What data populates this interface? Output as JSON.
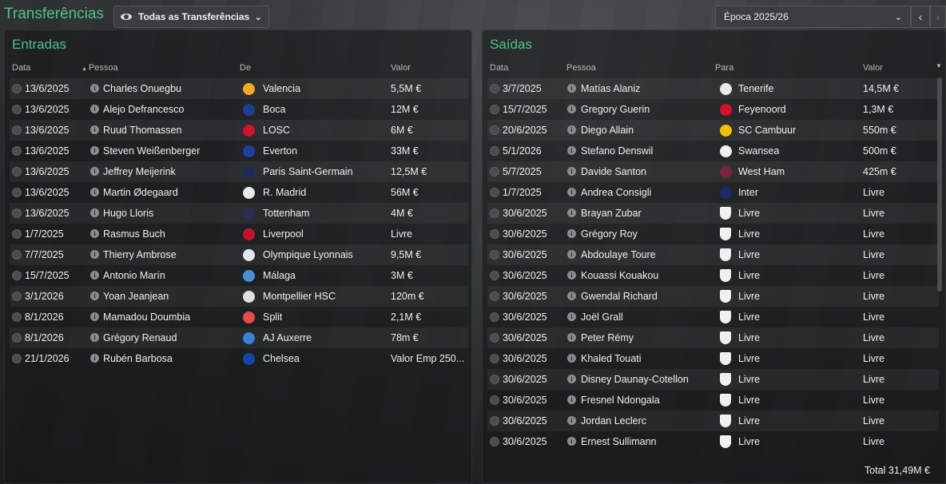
{
  "page": {
    "title": "Transferências",
    "filter_label": "Todas as Transferências",
    "season_label": "Época 2025/26"
  },
  "colors": {
    "accent": "#4fc28d"
  },
  "entradas": {
    "title": "Entradas",
    "headers": {
      "data": "Data",
      "pessoa": "Pessoa",
      "de": "De",
      "valor": "Valor"
    },
    "rows": [
      {
        "data": "13/6/2025",
        "pessoa": "Charles Onuegbu",
        "clube": "Valencia",
        "valor": "5,5M €",
        "badge": "#f5a623"
      },
      {
        "data": "13/6/2025",
        "pessoa": "Alejo Defrancesco",
        "clube": "Boca",
        "valor": "12M €",
        "badge": "#1d3f8f"
      },
      {
        "data": "13/6/2025",
        "pessoa": "Ruud Thomassen",
        "clube": "LOSC",
        "valor": "6M €",
        "badge": "#d0112b"
      },
      {
        "data": "13/6/2025",
        "pessoa": "Steven Weißenberger",
        "clube": "Everton",
        "valor": "33M €",
        "badge": "#1f3f9f"
      },
      {
        "data": "13/6/2025",
        "pessoa": "Jeffrey Meijerink",
        "clube": "Paris Saint-Germain",
        "valor": "12,5M €",
        "badge": "#1b2a5e"
      },
      {
        "data": "13/6/2025",
        "pessoa": "Martin Ødegaard",
        "clube": "R. Madrid",
        "valor": "56M €",
        "badge": "#e8e8e8"
      },
      {
        "data": "13/6/2025",
        "pessoa": "Hugo Lloris",
        "clube": "Tottenham",
        "valor": "4M €",
        "badge": "#2b2b5a"
      },
      {
        "data": "1/7/2025",
        "pessoa": "Rasmus Buch",
        "clube": "Liverpool",
        "valor": "Livre",
        "badge": "#c8102e"
      },
      {
        "data": "7/7/2025",
        "pessoa": "Thierry Ambrose",
        "clube": "Olympique Lyonnais",
        "valor": "9,5M €",
        "badge": "#e6e6f0"
      },
      {
        "data": "15/7/2025",
        "pessoa": "Antonio Marín",
        "clube": "Málaga",
        "valor": "3M €",
        "badge": "#4a90d9"
      },
      {
        "data": "3/1/2026",
        "pessoa": "Yoan Jeanjean",
        "clube": "Montpellier HSC",
        "valor": "120m €",
        "badge": "#e0e0e0"
      },
      {
        "data": "8/1/2026",
        "pessoa": "Mamadou Doumbia",
        "clube": "Split",
        "valor": "2,1M €",
        "badge": "#e84a4a"
      },
      {
        "data": "8/1/2026",
        "pessoa": "Grégory Renaud",
        "clube": "AJ Auxerre",
        "valor": "78m €",
        "badge": "#3a7fd5"
      },
      {
        "data": "21/1/2026",
        "pessoa": "Rubén Barbosa",
        "clube": "Chelsea",
        "valor": "Valor Emp 250...",
        "badge": "#1346a8"
      }
    ]
  },
  "saidas": {
    "title": "Saídas",
    "headers": {
      "data": "Data",
      "pessoa": "Pessoa",
      "para": "Para",
      "valor": "Valor"
    },
    "rows": [
      {
        "data": "3/7/2025",
        "pessoa": "Matías Alaniz",
        "clube": "Tenerife",
        "valor": "14,5M €",
        "badge": "#e8e8e8"
      },
      {
        "data": "15/7/2025",
        "pessoa": "Gregory Guerin",
        "clube": "Feyenoord",
        "valor": "1,3M €",
        "badge": "#d8102b"
      },
      {
        "data": "20/6/2025",
        "pessoa": "Diego Allain",
        "clube": "SC Cambuur",
        "valor": "550m €",
        "badge": "#f2c200"
      },
      {
        "data": "5/1/2026",
        "pessoa": "Stefano Denswil",
        "clube": "Swansea",
        "valor": "500m €",
        "badge": "#f0f0f0"
      },
      {
        "data": "5/7/2025",
        "pessoa": "Davide Santon",
        "clube": "West Ham",
        "valor": "425m €",
        "badge": "#7a263a"
      },
      {
        "data": "1/7/2025",
        "pessoa": "Andrea Consigli",
        "clube": "Inter",
        "valor": "Livre",
        "badge": "#1a2a6c"
      },
      {
        "data": "30/6/2025",
        "pessoa": "Brayan Zubar",
        "clube": "Livre",
        "valor": "Livre",
        "badge": "white"
      },
      {
        "data": "30/6/2025",
        "pessoa": "Grégory Roy",
        "clube": "Livre",
        "valor": "Livre",
        "badge": "white"
      },
      {
        "data": "30/6/2025",
        "pessoa": "Abdoulaye Toure",
        "clube": "Livre",
        "valor": "Livre",
        "badge": "white"
      },
      {
        "data": "30/6/2025",
        "pessoa": "Kouassi Kouakou",
        "clube": "Livre",
        "valor": "Livre",
        "badge": "white"
      },
      {
        "data": "30/6/2025",
        "pessoa": "Gwendal Richard",
        "clube": "Livre",
        "valor": "Livre",
        "badge": "white"
      },
      {
        "data": "30/6/2025",
        "pessoa": "Joël Grall",
        "clube": "Livre",
        "valor": "Livre",
        "badge": "white"
      },
      {
        "data": "30/6/2025",
        "pessoa": "Peter Rémy",
        "clube": "Livre",
        "valor": "Livre",
        "badge": "white"
      },
      {
        "data": "30/6/2025",
        "pessoa": "Khaled Touati",
        "clube": "Livre",
        "valor": "Livre",
        "badge": "white"
      },
      {
        "data": "30/6/2025",
        "pessoa": "Disney Daunay-Cotellon",
        "clube": "Livre",
        "valor": "Livre",
        "badge": "white"
      },
      {
        "data": "30/6/2025",
        "pessoa": "Fresnel Ndongala",
        "clube": "Livre",
        "valor": "Livre",
        "badge": "white"
      },
      {
        "data": "30/6/2025",
        "pessoa": "Jordan Leclerc",
        "clube": "Livre",
        "valor": "Livre",
        "badge": "white"
      },
      {
        "data": "30/6/2025",
        "pessoa": "Ernest Sullimann",
        "clube": "Livre",
        "valor": "Livre",
        "badge": "white"
      }
    ],
    "total": "Total 31,49M €"
  }
}
